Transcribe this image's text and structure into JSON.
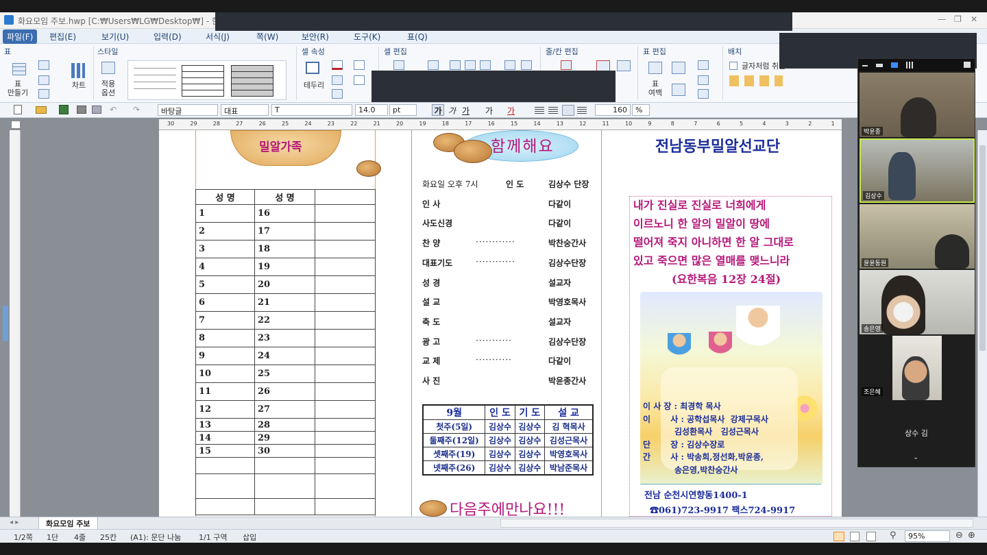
{
  "window": {
    "title": "화요모임 주보.hwp [C:₩Users₩LG₩Desktop₩] - 한컴",
    "controls": [
      "—",
      "❐",
      "✕"
    ]
  },
  "menu": [
    "파일(F)",
    "편집(E)",
    "보기(U)",
    "입력(D)",
    "서식(J)",
    "쪽(W)",
    "보안(R)",
    "도구(K)",
    "표(Q)"
  ],
  "ribbon": {
    "groups": [
      "표",
      "스타일",
      "셀 속성",
      "셀 편집",
      "줄/칸 편집",
      "표 편집",
      "배치"
    ],
    "buttons": {
      "make_table": "표\n만들기",
      "chart": "차트",
      "apply_options": "적용\n옵션",
      "border": "테두리",
      "table_margin": "표\n여백",
      "like_char": "글자처럼 취급"
    }
  },
  "format_bar": {
    "style": "바탕글",
    "font_lang": "대표",
    "font": "T",
    "size": "14.0",
    "unit": "pt",
    "bold": "가",
    "italic": "가",
    "underline": "가",
    "strike": "가",
    "color": "가",
    "line_spacing": "160",
    "percent": "%"
  },
  "ruler": [
    "30",
    "29",
    "28",
    "27",
    "26",
    "25",
    "24",
    "23",
    "22",
    "21",
    "20",
    "19",
    "18",
    "17",
    "16",
    "15",
    "14",
    "13",
    "12",
    "11",
    "10",
    "9",
    "8",
    "7",
    "6",
    "5",
    "4",
    "3",
    "2",
    "1"
  ],
  "doc": {
    "left_heading": "밀알가족",
    "member_header": [
      "성  명",
      "성  명"
    ],
    "members_left": [
      "1",
      "2",
      "3",
      "4",
      "5",
      "6",
      "7",
      "8",
      "9",
      "10",
      "11",
      "12",
      "13",
      "14",
      "15"
    ],
    "members_right": [
      "16",
      "17",
      "18",
      "19",
      "20",
      "21",
      "22",
      "23",
      "24",
      "25",
      "26",
      "27",
      "28",
      "29",
      "30"
    ],
    "together": "함께해요",
    "program": [
      {
        "item": "화요일 오후 7시",
        "role": "인 도",
        "dots": "",
        "name": "김상수 단장"
      },
      {
        "item": "인    사",
        "role": "",
        "dots": "",
        "name": "다같이"
      },
      {
        "item": "사도신경",
        "role": "",
        "dots": "",
        "name": "다같이"
      },
      {
        "item": "찬    양",
        "role": "",
        "dots": "············",
        "name": "박찬숭간사"
      },
      {
        "item": "대표기도",
        "role": "",
        "dots": "············",
        "name": "김상수단장"
      },
      {
        "item": "성    경",
        "role": "",
        "dots": "",
        "name": "설교자"
      },
      {
        "item": "설    교",
        "role": "",
        "dots": "",
        "name": "박영호목사"
      },
      {
        "item": "축    도",
        "role": "",
        "dots": "",
        "name": "설교자"
      },
      {
        "item": "광    고",
        "role": "",
        "dots": "···········",
        "name": "김상수단장"
      },
      {
        "item": "교    제",
        "role": "",
        "dots": "···········",
        "name": "다같이"
      },
      {
        "item": "사    진",
        "role": "",
        "dots": "",
        "name": "박윤종간사"
      }
    ],
    "schedule_header": [
      "9월",
      "인 도",
      "기 도",
      "설 교"
    ],
    "schedule": [
      [
        "첫주(5일)",
        "김상수",
        "김상수",
        "김 혁목사"
      ],
      [
        "둘째주(12일)",
        "김상수",
        "김상수",
        "김성근목사"
      ],
      [
        "셋째주(19)",
        "김상수",
        "김상수",
        "박영호목사"
      ],
      [
        "넷째주(26)",
        "김상수",
        "김상수",
        "박남준목사"
      ]
    ],
    "next_week": "다음주에만나요!!!",
    "org_title": "전남동부밀알선교단",
    "verse": [
      "내가 진실로 진실로 너희에게",
      "이르노니 한 알의 밀알이 땅에",
      "떨어져 죽지 아니하면 한 알 그대로",
      "있고 죽으면 많은 열매를 맺느니라"
    ],
    "verse_ref": "(요한복음 12장 24절)",
    "staff": [
      "이 사 장 : 최경학 목사",
      "이       사 : 공학섭목사  강제구목사",
      "           김성환목사   김성근목사",
      "단       장 : 김상수장로",
      "간       사 : 박송희,정선화,박윤종,",
      "           송은영,박찬숭간사"
    ],
    "address": "전남 순천시연향동1400-1",
    "phone": "☎061)723-9917 팩스724-9917"
  },
  "doc_tab": "화요모임 주보",
  "status": [
    "1/2쪽",
    "1단",
    "4줄",
    "25칸",
    "(A1): 문단 나눔",
    "1/1 구역",
    "삽입"
  ],
  "zoom_level": "95%",
  "participants": [
    "박윤종",
    "김상수",
    "윤윤동원",
    "송은영",
    "조은혜"
  ],
  "active_speaker": "상수 김",
  "colors": {
    "accent_menu": "#3b6db0",
    "verse": "#b5177a",
    "staff": "#1b2d9a",
    "title_blue": "#1b2d9a"
  }
}
